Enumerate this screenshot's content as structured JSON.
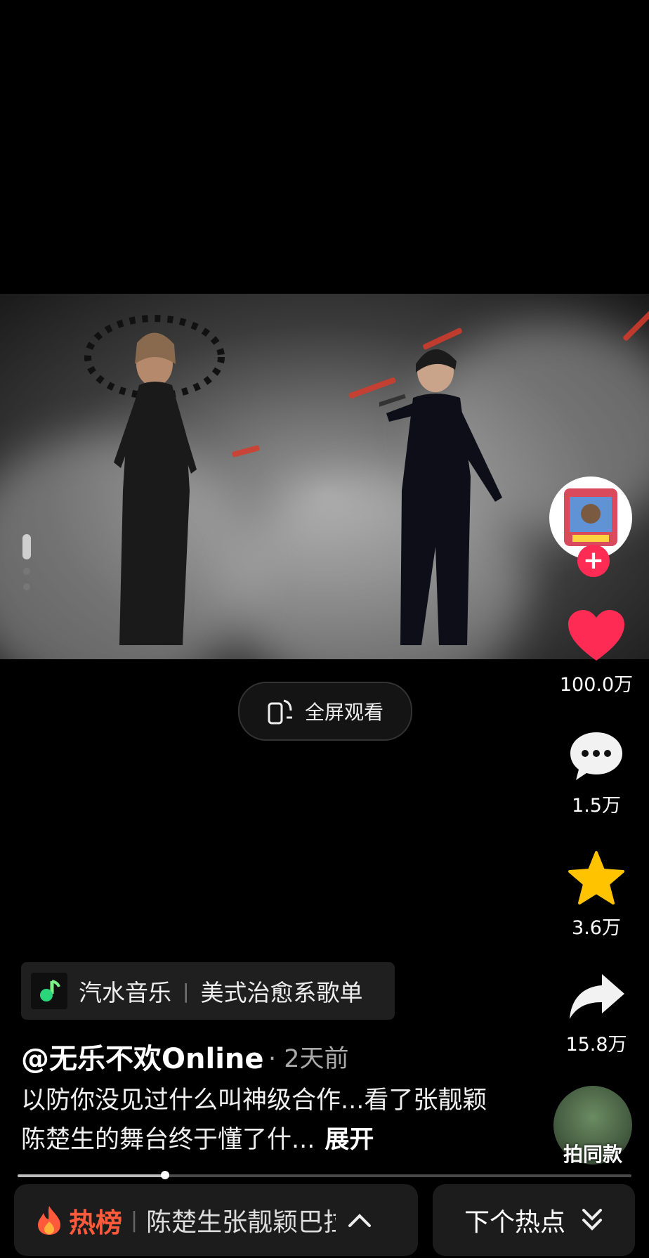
{
  "video": {
    "fullscreen_label": "全屏观看"
  },
  "actions": {
    "like_count": "100.0万",
    "comment_count": "1.5万",
    "favorite_count": "3.6万",
    "share_count": "15.8万",
    "remix_label": "拍同款"
  },
  "music": {
    "app": "汽水音乐",
    "playlist": "美式治愈系歌单"
  },
  "post": {
    "author": "@无乐不欢Online",
    "time": "· 2天前",
    "description": "以防你没见过什么叫神级合作...看了张靓颖陈楚生的舞台终于懂了什...",
    "expand_label": "展开"
  },
  "playback": {
    "progress": 0.24
  },
  "hot": {
    "label": "热榜",
    "topic": "陈楚生张靓颖巴拉",
    "next_label": "下个热点"
  },
  "colors": {
    "like": "#fe2c55",
    "favorite": "#ffc300",
    "hot": "#ff5a3c"
  }
}
